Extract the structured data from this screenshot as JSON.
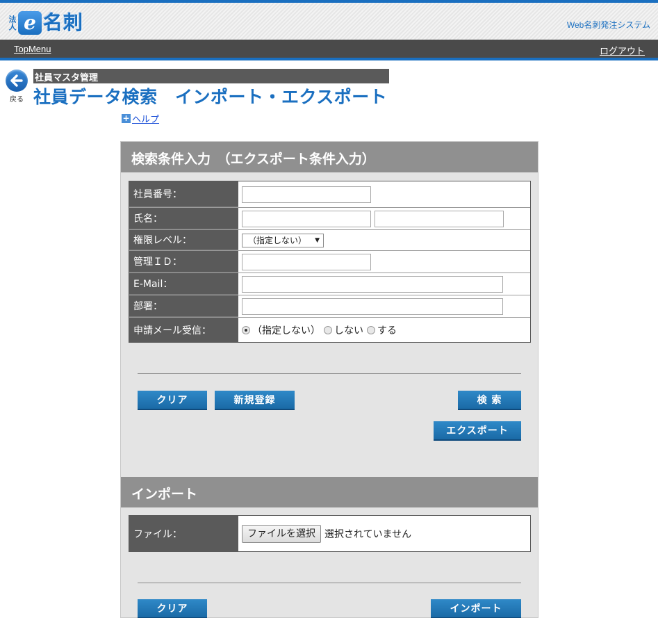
{
  "header": {
    "logo": {
      "hojin": "法人",
      "e": "e",
      "meishi": "名刺"
    },
    "system_name": "Web名刺発注システム"
  },
  "nav": {
    "top_menu": "TopMenu",
    "logout": "ログアウト"
  },
  "back": {
    "label": "戻る"
  },
  "breadcrumb": "社員マスタ管理",
  "page_title": "社員データ検索　インポート・エクスポート",
  "help": {
    "icon": "+",
    "label": "ヘルプ"
  },
  "search_section": {
    "title": "検索条件入力　（エクスポート条件入力）",
    "fields": {
      "employee_no": {
        "label": "社員番号：",
        "value": ""
      },
      "name": {
        "label": "氏名：",
        "value1": "",
        "value2": ""
      },
      "permission": {
        "label": "権限レベル：",
        "selected": "（指定しない）",
        "arrow": "▼"
      },
      "admin_id": {
        "label": "管理ＩＤ：",
        "value": ""
      },
      "email": {
        "label": "E-Mail：",
        "value": ""
      },
      "department": {
        "label": "部署：",
        "value": ""
      },
      "mail_receive": {
        "label": "申請メール受信：",
        "options": [
          "（指定しない）",
          "しない",
          "する"
        ],
        "selected_index": 0
      }
    },
    "buttons": {
      "clear": "クリア",
      "new": "新規登録",
      "search": "検 索",
      "export": "エクスポート"
    }
  },
  "import_section": {
    "title": "インポート",
    "file": {
      "label": "ファイル：",
      "button": "ファイルを選択",
      "status": "選択されていません"
    },
    "buttons": {
      "clear": "クリア",
      "import": "インポート"
    }
  },
  "colors": {
    "accent": "#1a6fc0",
    "label_bg": "#5a5a5a",
    "section_bg": "#909090",
    "panel_bg": "#e4e4e4"
  }
}
